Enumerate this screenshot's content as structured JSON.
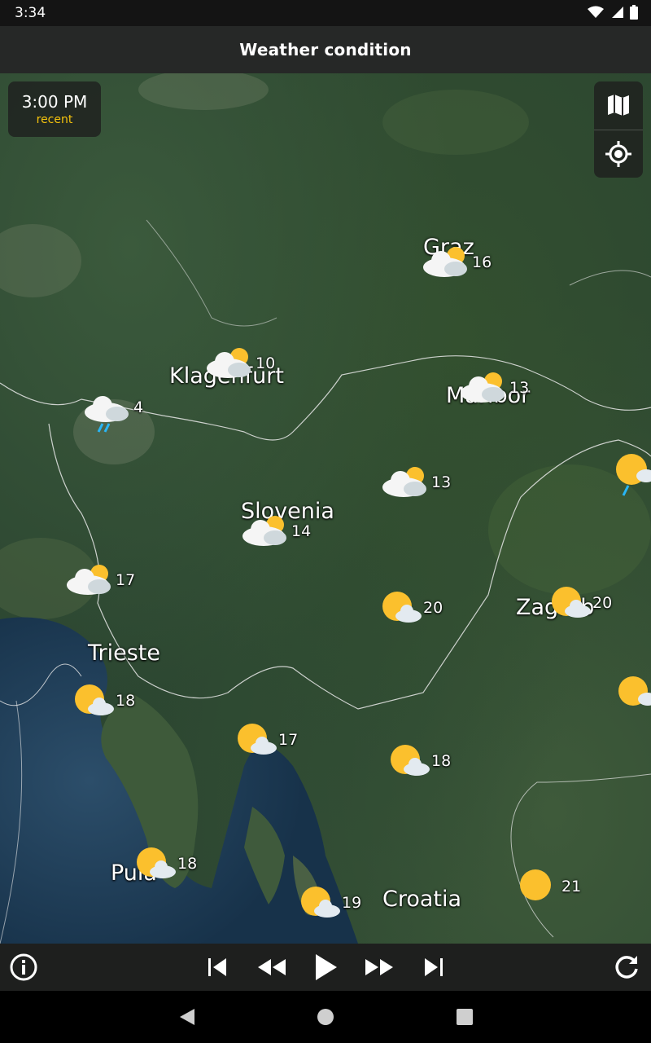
{
  "status": {
    "time": "3:34"
  },
  "header": {
    "title": "Weather condition"
  },
  "time_badge": {
    "time": "3:00 PM",
    "label": "recent"
  },
  "map": {
    "places": [
      {
        "name": "Graz"
      },
      {
        "name": "Klagenfurt"
      },
      {
        "name": "Maribor"
      },
      {
        "name": "Slovenia"
      },
      {
        "name": "Zagreb"
      },
      {
        "name": "Trieste"
      },
      {
        "name": "Pula"
      },
      {
        "name": "Croatia"
      }
    ],
    "markers": [
      {
        "temp": "16",
        "icon": "partly-cloudy-icon"
      },
      {
        "temp": "10",
        "icon": "partly-cloudy-icon"
      },
      {
        "temp": "4",
        "icon": "rain-cloud-icon"
      },
      {
        "temp": "13",
        "icon": "partly-cloudy-icon"
      },
      {
        "temp": "13",
        "icon": "partly-cloudy-icon"
      },
      {
        "temp": "14",
        "icon": "partly-cloudy-icon"
      },
      {
        "temp": "17",
        "icon": "partly-cloudy-icon"
      },
      {
        "temp": "20",
        "icon": "sun-cloud-icon"
      },
      {
        "temp": "20",
        "icon": "sun-cloud-icon"
      },
      {
        "temp": "18",
        "icon": "sun-cloud-icon"
      },
      {
        "temp": "17",
        "icon": "sun-cloud-icon"
      },
      {
        "temp": "18",
        "icon": "sun-cloud-icon"
      },
      {
        "temp": "18",
        "icon": "sun-cloud-icon"
      },
      {
        "temp": "19",
        "icon": "sun-cloud-icon"
      },
      {
        "temp": "21",
        "icon": "sun-icon"
      }
    ]
  },
  "colors": {
    "accent": "#f4c20d",
    "sun": "#fbc02d",
    "rain": "#29b6f6"
  }
}
